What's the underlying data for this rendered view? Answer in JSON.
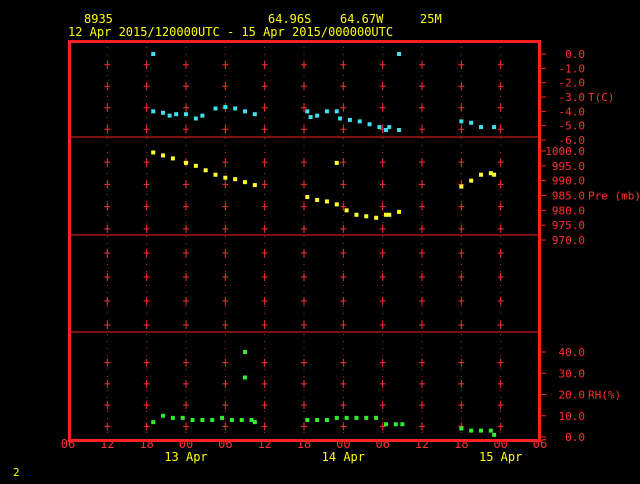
{
  "header": {
    "station_id": "8935",
    "lat": "64.96S",
    "lon": "64.67W",
    "elev": "25M",
    "time_range": "12 Apr 2015/120000UTC - 15 Apr 2015/000000UTC"
  },
  "footer": {
    "page_number": "2"
  },
  "colors": {
    "background": "#000000",
    "frame": "#ff2020",
    "grid": "#ff3030",
    "label": "#ff3030",
    "header_text": "#ffff00",
    "temp": "#40e0f0",
    "pressure": "#ffff30",
    "rh": "#30ee30"
  },
  "chart_data": {
    "type": "scatter",
    "x_unit": "hours since 12 Apr 2015 06 UTC",
    "x_range": [
      0,
      72
    ],
    "x_ticks": [
      "06",
      "12",
      "18",
      "00",
      "06",
      "12",
      "18",
      "00",
      "06",
      "12",
      "18",
      "00",
      "06"
    ],
    "date_labels": [
      {
        "x": 18,
        "text": "13 Apr"
      },
      {
        "x": 42,
        "text": "14 Apr"
      },
      {
        "x": 66,
        "text": "15 Apr"
      }
    ],
    "panels": [
      {
        "name": "T(C)",
        "label": "T(C)",
        "ylim": [
          -6,
          0.5
        ],
        "ticks": [
          0,
          -1,
          -2,
          -3,
          -4,
          -5,
          -6
        ],
        "tick_labels": [
          "0.0",
          "-1.0",
          "-2.0",
          "-3.0",
          "-4.0",
          "-5.0",
          "-6.0"
        ],
        "color_key": "temp",
        "points": [
          [
            13,
            0.0
          ],
          [
            13,
            -4.0
          ],
          [
            14.5,
            -4.1
          ],
          [
            15.5,
            -4.3
          ],
          [
            16.5,
            -4.2
          ],
          [
            18,
            -4.2
          ],
          [
            19.5,
            -4.5
          ],
          [
            20.5,
            -4.3
          ],
          [
            22.5,
            -3.8
          ],
          [
            24,
            -3.7
          ],
          [
            25.5,
            -3.8
          ],
          [
            27,
            -4.0
          ],
          [
            28.5,
            -4.2
          ],
          [
            36.5,
            -4.0
          ],
          [
            37,
            -4.4
          ],
          [
            38,
            -4.3
          ],
          [
            39.5,
            -4.0
          ],
          [
            41,
            -4.0
          ],
          [
            41.5,
            -4.5
          ],
          [
            43,
            -4.6
          ],
          [
            44.5,
            -4.7
          ],
          [
            46,
            -4.9
          ],
          [
            47.5,
            -5.1
          ],
          [
            48.5,
            -5.3
          ],
          [
            49,
            -5.1
          ],
          [
            50.5,
            -5.3
          ],
          [
            50.5,
            0.0
          ],
          [
            60,
            -4.7
          ],
          [
            61.5,
            -4.8
          ],
          [
            63,
            -5.1
          ],
          [
            65,
            -5.1
          ]
        ]
      },
      {
        "name": "Pre (mb)",
        "label": "Pre (mb)",
        "ylim": [
          968,
          1002
        ],
        "ticks": [
          1000,
          995,
          990,
          985,
          980,
          975,
          970
        ],
        "tick_labels": [
          "1000.0",
          "995.0",
          "990.0",
          "985.0",
          "980.0",
          "975.0",
          "970.0"
        ],
        "color_key": "pressure",
        "points": [
          [
            13,
            999.5
          ],
          [
            14.5,
            998.5
          ],
          [
            16,
            997.5
          ],
          [
            18,
            996.0
          ],
          [
            19.5,
            995.0
          ],
          [
            21,
            993.5
          ],
          [
            22.5,
            992.0
          ],
          [
            24,
            991.0
          ],
          [
            25.5,
            990.5
          ],
          [
            27,
            989.5
          ],
          [
            28.5,
            988.5
          ],
          [
            36.5,
            984.5
          ],
          [
            38,
            983.5
          ],
          [
            39.5,
            983.0
          ],
          [
            41,
            982.0
          ],
          [
            41,
            996.0
          ],
          [
            42.5,
            980.0
          ],
          [
            44,
            978.5
          ],
          [
            45.5,
            978.0
          ],
          [
            47,
            977.5
          ],
          [
            48.5,
            978.5
          ],
          [
            49,
            978.5
          ],
          [
            50.5,
            979.5
          ],
          [
            60,
            988.0
          ],
          [
            61.5,
            990.0
          ],
          [
            63,
            992.0
          ],
          [
            64.5,
            992.5
          ],
          [
            65,
            992.0
          ]
        ]
      },
      {
        "name": "empty",
        "label": "",
        "ylim": [
          0,
          1
        ],
        "ticks": [],
        "tick_labels": [],
        "color_key": "rh",
        "points": []
      },
      {
        "name": "RH(%)",
        "label": "RH(%)",
        "ylim": [
          -1,
          47
        ],
        "ticks": [
          40,
          30,
          20,
          10,
          0
        ],
        "tick_labels": [
          "40.0",
          "30.0",
          "20.0",
          "10.0",
          "0.0"
        ],
        "color_key": "rh",
        "points": [
          [
            13,
            7
          ],
          [
            14.5,
            10
          ],
          [
            16,
            9
          ],
          [
            17.5,
            9
          ],
          [
            19,
            8
          ],
          [
            20.5,
            8
          ],
          [
            22,
            8
          ],
          [
            23.5,
            9
          ],
          [
            25,
            8
          ],
          [
            26.5,
            8
          ],
          [
            27,
            40
          ],
          [
            27,
            28
          ],
          [
            28,
            8
          ],
          [
            28.5,
            7
          ],
          [
            36.5,
            8
          ],
          [
            38,
            8
          ],
          [
            39.5,
            8
          ],
          [
            41,
            9
          ],
          [
            42.5,
            9
          ],
          [
            44,
            9
          ],
          [
            45.5,
            9
          ],
          [
            47,
            9
          ],
          [
            48.5,
            6
          ],
          [
            50,
            6
          ],
          [
            51,
            6
          ],
          [
            60,
            4
          ],
          [
            61.5,
            3
          ],
          [
            63,
            3
          ],
          [
            64.5,
            3
          ],
          [
            65,
            1
          ]
        ]
      }
    ]
  }
}
